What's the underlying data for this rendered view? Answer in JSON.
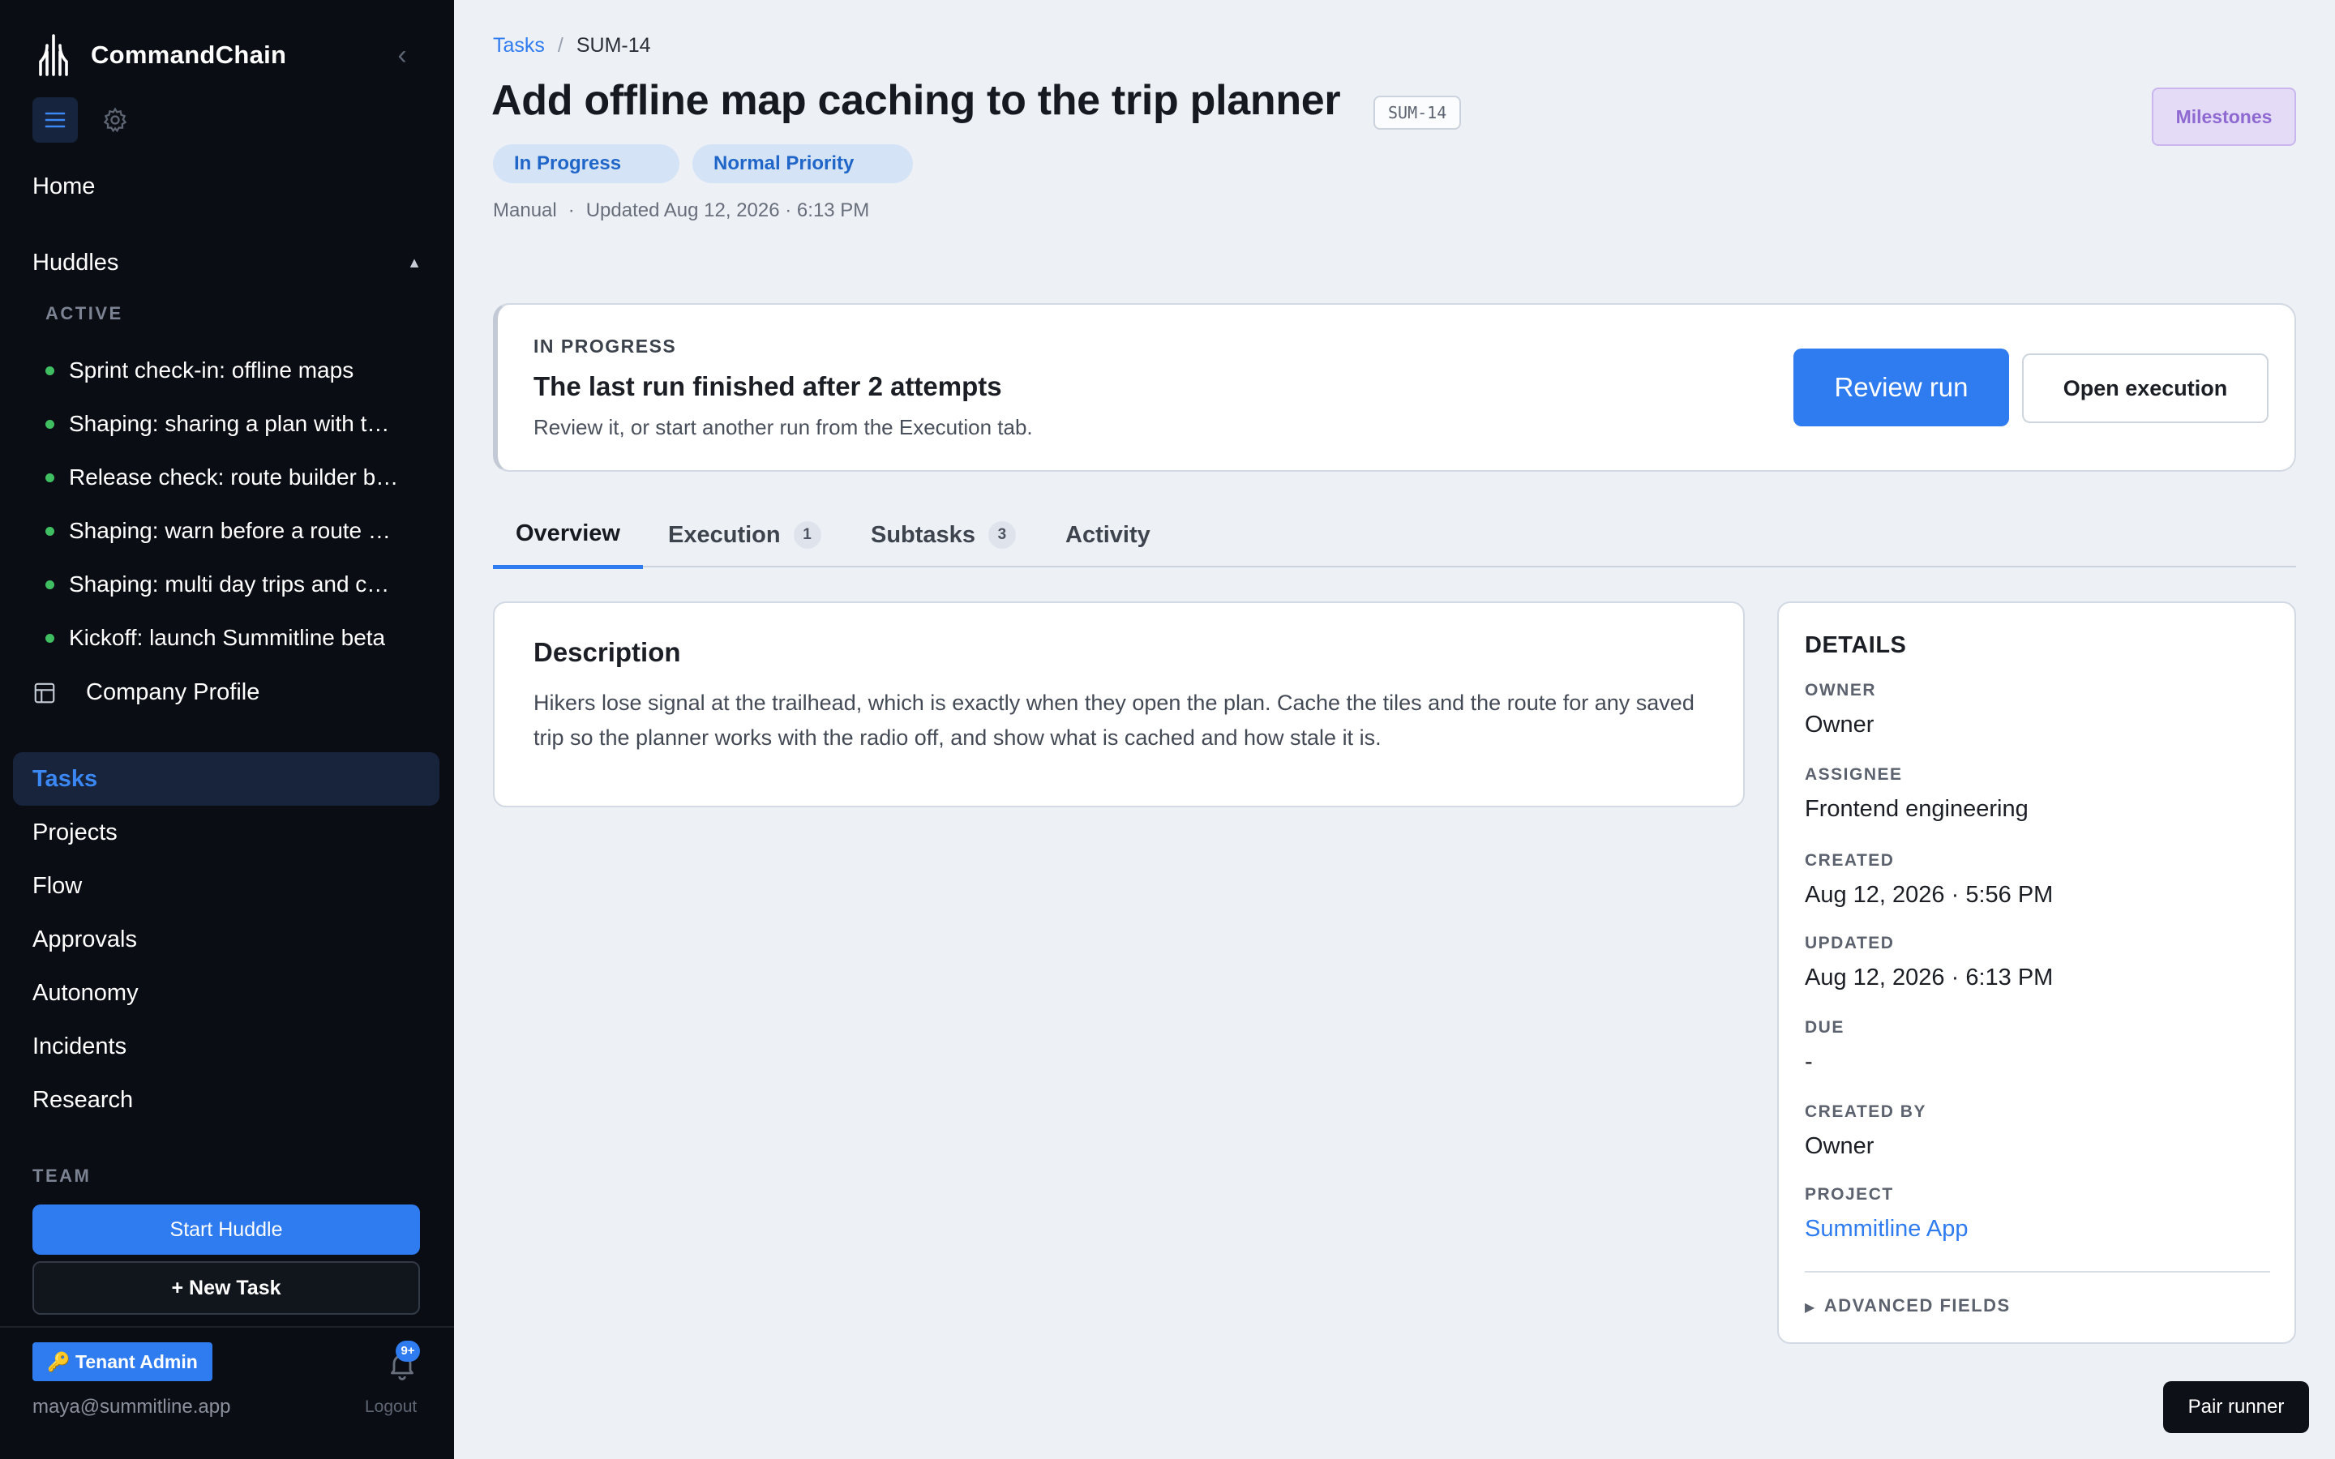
{
  "app": {
    "name": "CommandChain"
  },
  "sidebar": {
    "home": "Home",
    "huddles": {
      "label": "Huddles",
      "caret": "▲",
      "section": "ACTIVE",
      "items": [
        {
          "label": "Sprint check-in: offline maps"
        },
        {
          "label": "Shaping: sharing a plan with t…"
        },
        {
          "label": "Release check: route builder b…"
        },
        {
          "label": "Shaping: warn before a route …"
        },
        {
          "label": "Shaping: multi day trips and c…"
        },
        {
          "label": "Kickoff: launch Summitline beta"
        }
      ]
    },
    "company_profile": "Company Profile",
    "nav": [
      {
        "label": "Tasks",
        "active": true
      },
      {
        "label": "Projects"
      },
      {
        "label": "Flow"
      },
      {
        "label": "Approvals"
      },
      {
        "label": "Autonomy"
      },
      {
        "label": "Incidents"
      },
      {
        "label": "Research"
      }
    ],
    "team_label": "TEAM",
    "start_huddle": "Start Huddle",
    "new_task": "+ New Task",
    "admin_badge": "🔑 Tenant Admin",
    "notifications": "9+",
    "user_email": "maya@summitline.app",
    "logout": "Logout"
  },
  "breadcrumb": {
    "parent": "Tasks",
    "separator": "/",
    "current": "SUM-14"
  },
  "task": {
    "title": "Add offline map caching to the trip planner",
    "id": "SUM-14",
    "status": "In Progress",
    "priority": "Normal Priority",
    "source": "Manual",
    "meta_sep": "·",
    "updated": "Updated Aug 12, 2026 · 6:13 PM"
  },
  "header_actions": {
    "milestones": "Milestones"
  },
  "status_card": {
    "label": "IN PROGRESS",
    "title": "The last run finished after 2 attempts",
    "subtitle": "Review it, or start another run from the Execution tab.",
    "primary": "Review run",
    "secondary": "Open execution"
  },
  "tabs": [
    {
      "label": "Overview",
      "active": true
    },
    {
      "label": "Execution",
      "count": "1"
    },
    {
      "label": "Subtasks",
      "count": "3"
    },
    {
      "label": "Activity"
    }
  ],
  "description": {
    "title": "Description",
    "body": "Hikers lose signal at the trailhead, which is exactly when they open the plan. Cache the tiles and the route for any saved trip so the planner works with the radio off, and show what is cached and how stale it is."
  },
  "details": {
    "title": "DETAILS",
    "owner": {
      "label": "OWNER",
      "value": "Owner"
    },
    "assignee": {
      "label": "ASSIGNEE",
      "value": "Frontend engineering"
    },
    "created": {
      "label": "CREATED",
      "value": "Aug 12, 2026 · 5:56 PM"
    },
    "updated": {
      "label": "UPDATED",
      "value": "Aug 12, 2026 · 6:13 PM"
    },
    "due": {
      "label": "DUE",
      "value": "-"
    },
    "created_by": {
      "label": "CREATED BY",
      "value": "Owner"
    },
    "project": {
      "label": "PROJECT",
      "value": "Summitline App"
    },
    "advanced": "ADVANCED FIELDS"
  },
  "pair_runner": "Pair runner",
  "colors": {
    "accent": "#2f7cf0",
    "sidebar_bg": "#0a0d14",
    "page_bg": "#edf1f6",
    "status_dot": "#3fbf62",
    "milestones": "#8d69d1"
  },
  "icons": [
    "logo-icon",
    "chevron-left-icon",
    "menu-icon",
    "gear-icon",
    "layout-icon",
    "bell-icon",
    "key-icon"
  ]
}
